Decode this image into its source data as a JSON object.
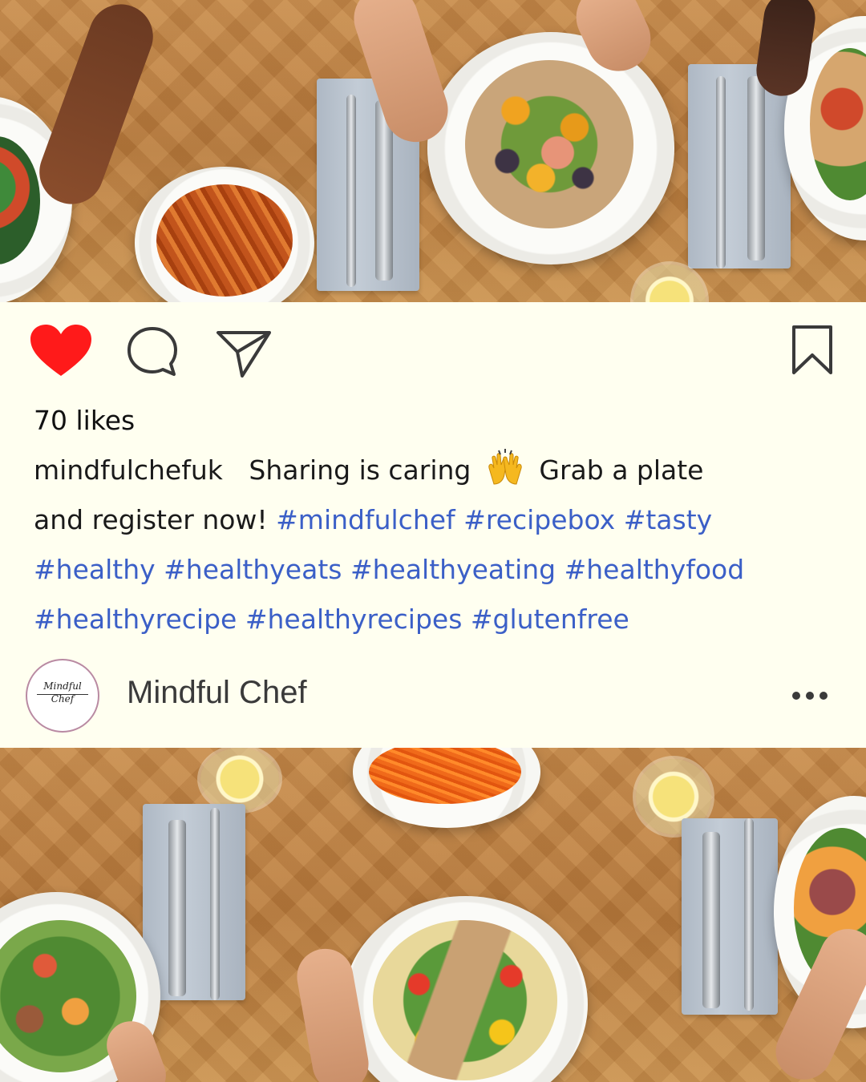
{
  "post": {
    "likes": "70 likes",
    "username": "mindfulchefuk",
    "caption_text_1": "Sharing is caring",
    "caption_text_2": "Grab a plate",
    "caption_text_3": "and register now!",
    "hashtags_line1": [
      "#mindfulchef",
      "#recipebox",
      "#tasty"
    ],
    "hashtags_line2": [
      "#healthy",
      "#healthyeats",
      "#healthyeating",
      "#healthyfood"
    ],
    "hashtags_line3": [
      "#healthyrecipe",
      "#healthyrecipes",
      "#glutenfree"
    ],
    "emoji": "raising-hands"
  },
  "account": {
    "display_name": "Mindful Chef",
    "avatar_text_1": "Mindful",
    "avatar_text_2": "Chef"
  },
  "icons": {
    "like": "heart-icon",
    "comment": "comment-icon",
    "share": "share-icon",
    "save": "bookmark-icon",
    "more": "more-icon"
  },
  "colors": {
    "liked_heart": "#ff1a1a",
    "hashtag": "#3b5fc7",
    "panel_background": "#fffff0"
  }
}
